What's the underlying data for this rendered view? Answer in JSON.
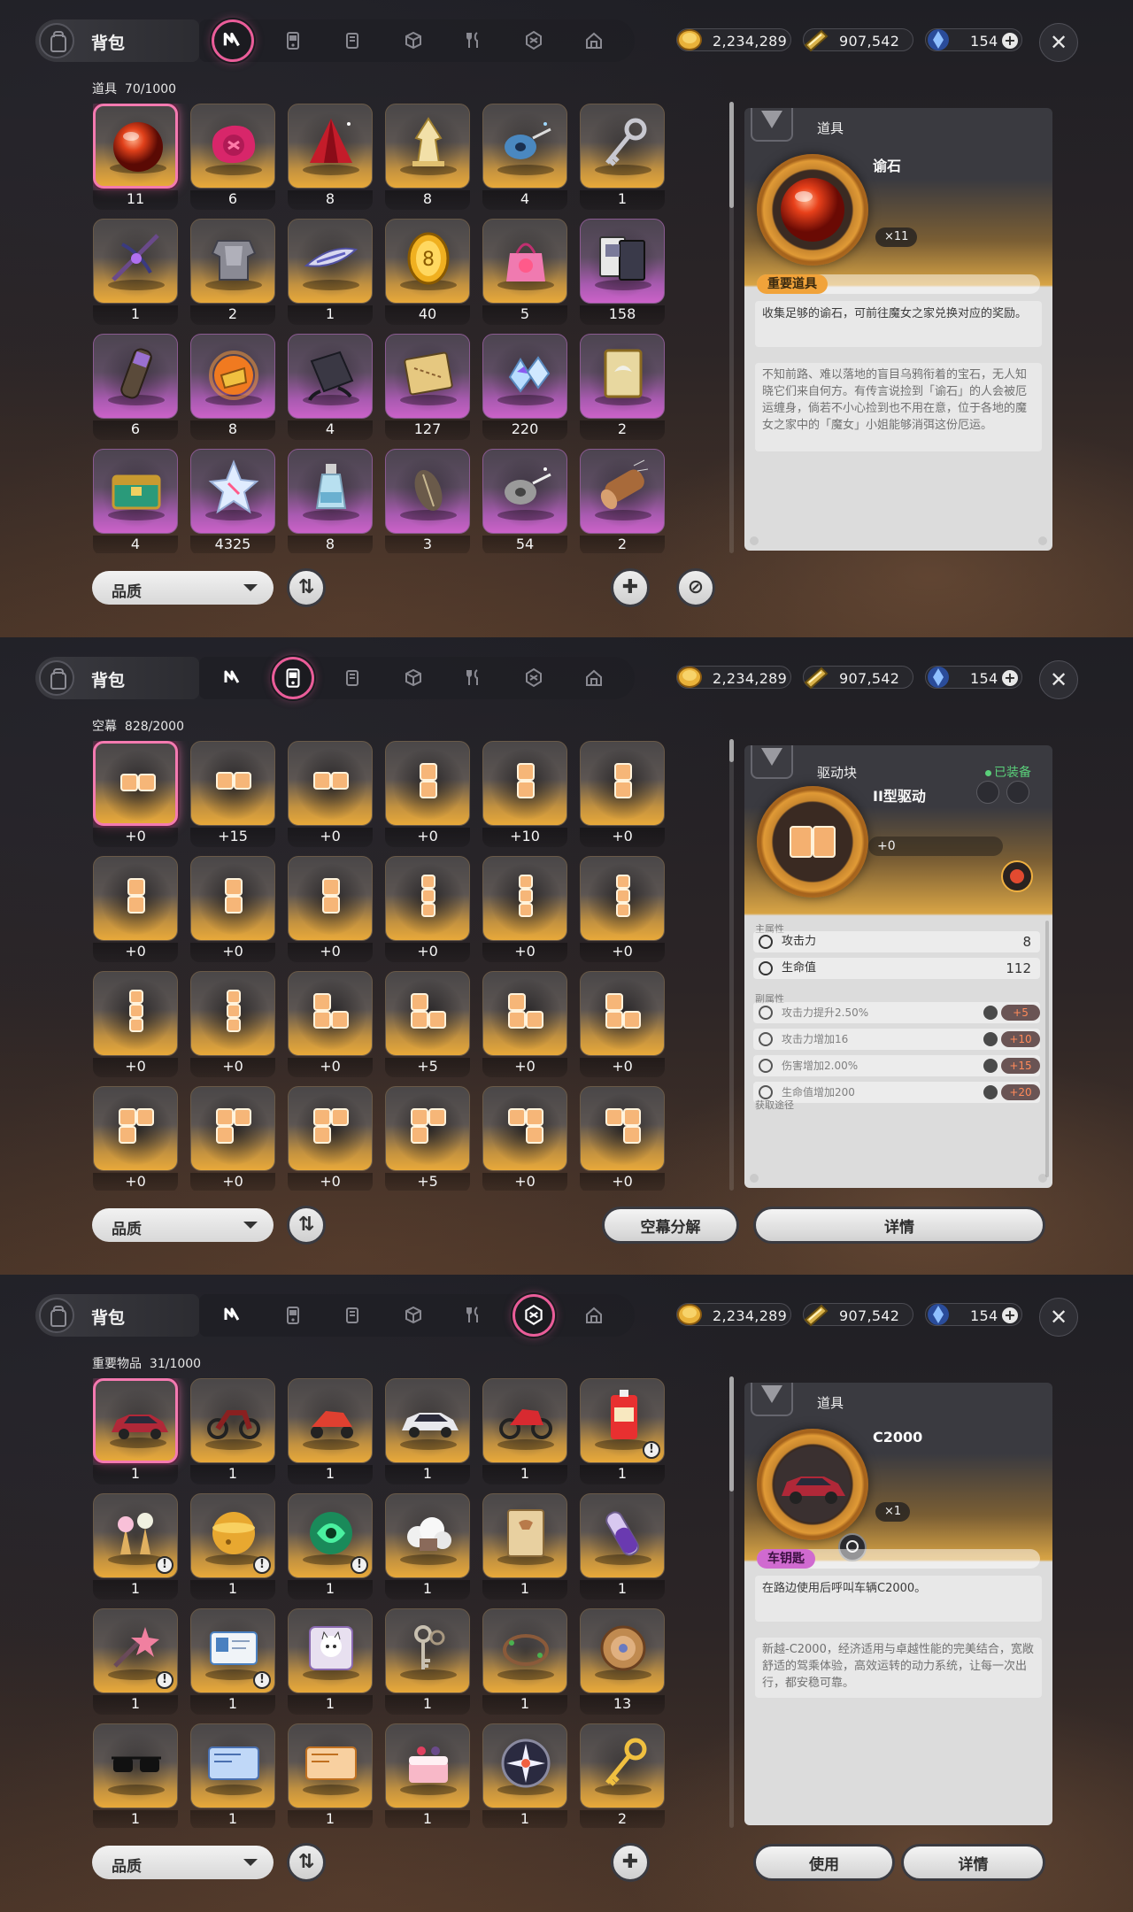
{
  "currency": {
    "gold": "2,234,289",
    "ticket": "907,542",
    "crystal": "154"
  },
  "colors": {
    "accent_pink": "#ea5d99",
    "gold_card": "#e8a93a",
    "purple_card": "#cb62c8"
  },
  "panel1": {
    "title": "背包",
    "active_tab": 0,
    "count_label": "道具",
    "count": "70/1000",
    "items": [
      {
        "q": "11",
        "c": "gold",
        "icon": "red-orb",
        "sel": true
      },
      {
        "q": "6",
        "c": "gold",
        "icon": "pink-seal"
      },
      {
        "q": "8",
        "c": "gold",
        "icon": "red-cloak"
      },
      {
        "q": "8",
        "c": "gold",
        "icon": "chess-piece"
      },
      {
        "q": "4",
        "c": "gold",
        "icon": "thread-spool"
      },
      {
        "q": "1",
        "c": "gold",
        "icon": "silver-key"
      },
      {
        "q": "1",
        "c": "gold",
        "icon": "magic-crossbow"
      },
      {
        "q": "2",
        "c": "gold",
        "icon": "armor"
      },
      {
        "q": "1",
        "c": "gold",
        "icon": "surfboard"
      },
      {
        "q": "40",
        "c": "gold",
        "icon": "gold-coin"
      },
      {
        "q": "5",
        "c": "gold",
        "icon": "gift-bag"
      },
      {
        "q": "158",
        "c": "purple",
        "icon": "cards"
      },
      {
        "q": "6",
        "c": "purple",
        "icon": "scroll-tube"
      },
      {
        "q": "8",
        "c": "purple",
        "icon": "fire-gem"
      },
      {
        "q": "4",
        "c": "purple",
        "icon": "dark-book"
      },
      {
        "q": "127",
        "c": "purple",
        "icon": "treasure-map"
      },
      {
        "q": "220",
        "c": "purple",
        "icon": "crystals"
      },
      {
        "q": "2",
        "c": "purple",
        "icon": "bird-card"
      },
      {
        "q": "4",
        "c": "purple",
        "icon": "green-chest"
      },
      {
        "q": "4325",
        "c": "purple",
        "icon": "ice-shard"
      },
      {
        "q": "8",
        "c": "purple",
        "icon": "potion-bottle"
      },
      {
        "q": "3",
        "c": "purple",
        "icon": "seed"
      },
      {
        "q": "54",
        "c": "purple",
        "icon": "thread-spool-gray"
      },
      {
        "q": "2",
        "c": "purple",
        "icon": "log"
      }
    ],
    "sort_label": "品质",
    "detail": {
      "category": "道具",
      "name": "谕石",
      "qty": "×11",
      "tag": "重要道具",
      "desc": "收集足够的谕石，可前往魔女之家兑换对应的奖励。",
      "lore": "不知前路、难以落地的盲目乌鸦衔着的宝石，无人知晓它们来自何方。有传言说捡到「谕石」的人会被厄运缠身，倘若不小心捡到也不用在意，位于各地的魔女之家中的「魔女」小姐能够消弭这份厄运。"
    }
  },
  "panel2": {
    "title": "背包",
    "active_tab": 1,
    "count_label": "空幕",
    "count": "828/2000",
    "items": [
      {
        "q": "+0",
        "shape": "h2",
        "sel": true
      },
      {
        "q": "+15",
        "shape": "h2"
      },
      {
        "q": "+0",
        "shape": "h2"
      },
      {
        "q": "+0",
        "shape": "v2"
      },
      {
        "q": "+10",
        "shape": "v2"
      },
      {
        "q": "+0",
        "shape": "v2"
      },
      {
        "q": "+0",
        "shape": "v2"
      },
      {
        "q": "+0",
        "shape": "v2"
      },
      {
        "q": "+0",
        "shape": "v2"
      },
      {
        "q": "+0",
        "shape": "v3"
      },
      {
        "q": "+0",
        "shape": "v3"
      },
      {
        "q": "+0",
        "shape": "v3"
      },
      {
        "q": "+0",
        "shape": "v3"
      },
      {
        "q": "+0",
        "shape": "v3"
      },
      {
        "q": "+0",
        "shape": "L"
      },
      {
        "q": "+5",
        "shape": "L"
      },
      {
        "q": "+0",
        "shape": "L"
      },
      {
        "q": "+0",
        "shape": "L"
      },
      {
        "q": "+0",
        "shape": "G"
      },
      {
        "q": "+0",
        "shape": "G"
      },
      {
        "q": "+0",
        "shape": "G"
      },
      {
        "q": "+5",
        "shape": "G"
      },
      {
        "q": "+0",
        "shape": "J"
      },
      {
        "q": "+0",
        "shape": "J"
      }
    ],
    "sort_label": "品质",
    "btn_decompose": "空幕分解",
    "btn_detail": "详情",
    "detail": {
      "category": "驱动块",
      "equipped": "已装备",
      "name": "II型驱动",
      "level": "+0",
      "main_label": "主属性",
      "main": [
        {
          "n": "攻击力",
          "v": "8",
          "icon": "attack"
        },
        {
          "n": "生命值",
          "v": "112",
          "icon": "heart"
        }
      ],
      "sub_label": "副属性",
      "sub": [
        {
          "n": "攻击力提升2.50%",
          "add": "+5",
          "icon": "attack"
        },
        {
          "n": "攻击力增加16",
          "add": "+10",
          "icon": "attack"
        },
        {
          "n": "伤害增加2.00%",
          "add": "+15",
          "icon": "triangle"
        },
        {
          "n": "生命值增加200",
          "add": "+20",
          "icon": "heart"
        }
      ],
      "source_label": "获取途径"
    }
  },
  "panel3": {
    "title": "背包",
    "active_tab": 5,
    "count_label": "重要物品",
    "count": "31/1000",
    "items": [
      {
        "q": "1",
        "icon": "red-car",
        "sel": true
      },
      {
        "q": "1",
        "icon": "motorbike"
      },
      {
        "q": "1",
        "icon": "scooter"
      },
      {
        "q": "1",
        "icon": "white-car"
      },
      {
        "q": "1",
        "icon": "red-motorbike"
      },
      {
        "q": "1",
        "icon": "drink-pack",
        "warn": true
      },
      {
        "q": "1",
        "icon": "ice-creams",
        "warn": true
      },
      {
        "q": "1",
        "icon": "gold-sphere",
        "warn": true
      },
      {
        "q": "1",
        "icon": "green-orb",
        "warn": true
      },
      {
        "q": "1",
        "icon": "cloud-box"
      },
      {
        "q": "1",
        "icon": "notebook"
      },
      {
        "q": "1",
        "icon": "vial"
      },
      {
        "q": "1",
        "icon": "star-wand",
        "warn": true
      },
      {
        "q": "1",
        "icon": "id-card",
        "warn": true
      },
      {
        "q": "1",
        "icon": "cat-sticker"
      },
      {
        "q": "1",
        "icon": "key-pair"
      },
      {
        "q": "1",
        "icon": "vine-ring"
      },
      {
        "q": "13",
        "icon": "bronze-coin"
      },
      {
        "q": "1",
        "icon": "sunglasses"
      },
      {
        "q": "1",
        "icon": "blue-ticket"
      },
      {
        "q": "1",
        "icon": "orange-ticket"
      },
      {
        "q": "1",
        "icon": "cake"
      },
      {
        "q": "1",
        "icon": "sparkle-orb"
      },
      {
        "q": "2",
        "icon": "gold-key"
      }
    ],
    "sort_label": "品质",
    "btn_use": "使用",
    "btn_detail": "详情",
    "detail": {
      "category": "道具",
      "name": "C2000",
      "qty": "×1",
      "tag": "车钥匙",
      "desc": "在路边使用后呼叫车辆C2000。",
      "lore": "新越-C2000，经济适用与卓越性能的完美结合，宽敞舒适的驾乘体验，高效运转的动力系统，让每一次出行，都安稳可靠。"
    }
  }
}
